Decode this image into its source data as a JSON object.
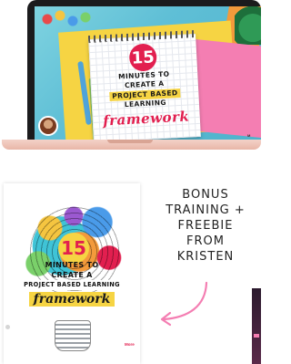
{
  "laptop": {
    "badge": "15",
    "line1": "MINUTES TO",
    "line2": "CREATE A",
    "line3": "PROJECT BASED",
    "line4": "LEARNING",
    "script": "framework",
    "logo": "M"
  },
  "book": {
    "badge": "15",
    "line1": "MINUTES TO",
    "line2": "CREATE A",
    "line3": "PROJECT BASED LEARNING",
    "script": "framework",
    "logo": "More"
  },
  "bonus": {
    "lines": [
      "BONUS",
      "TRAINING +",
      "FREEBIE",
      "FROM",
      "KRISTEN"
    ]
  },
  "colors": {
    "accent_pink": "#e21f4f",
    "highlight_yellow": "#f6d443",
    "arrow": "#f47eb2"
  }
}
